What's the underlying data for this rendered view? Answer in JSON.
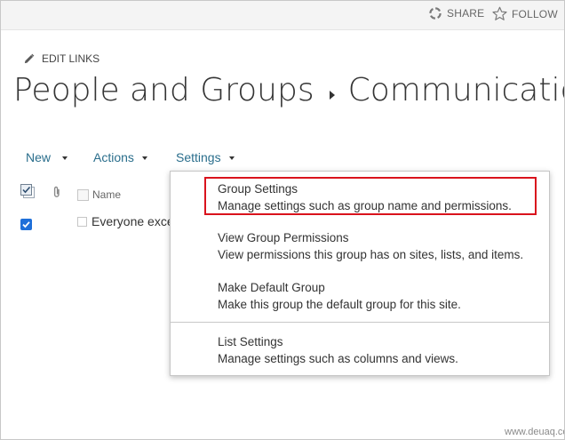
{
  "topbar": {
    "share_label": "SHARE",
    "follow_label": "FOLLOW"
  },
  "edit_links": {
    "label": "EDIT LINKS"
  },
  "title": {
    "site": "People and Groups",
    "separator": "▸",
    "page": "Communication"
  },
  "commands": {
    "new_label": "New",
    "actions_label": "Actions",
    "settings_label": "Settings"
  },
  "list": {
    "name_header": "Name",
    "rows": [
      {
        "name": "Everyone exce",
        "selected": true
      }
    ]
  },
  "settings_menu": {
    "items": [
      {
        "title": "Group Settings",
        "description": "Manage settings such as group name and permissions.",
        "highlighted": true
      },
      {
        "title": "View Group Permissions",
        "description": "View permissions this group has on sites, lists, and items."
      },
      {
        "title": "Make Default Group",
        "description": "Make this group the default group for this site."
      },
      {
        "title": "List Settings",
        "description": "Manage settings such as columns and views."
      }
    ]
  },
  "colors": {
    "command_text": "#2a6e8c",
    "highlight_border": "#d9131d",
    "checkbox_selected": "#1e6fd9"
  },
  "watermark": "www.deuaq.com"
}
